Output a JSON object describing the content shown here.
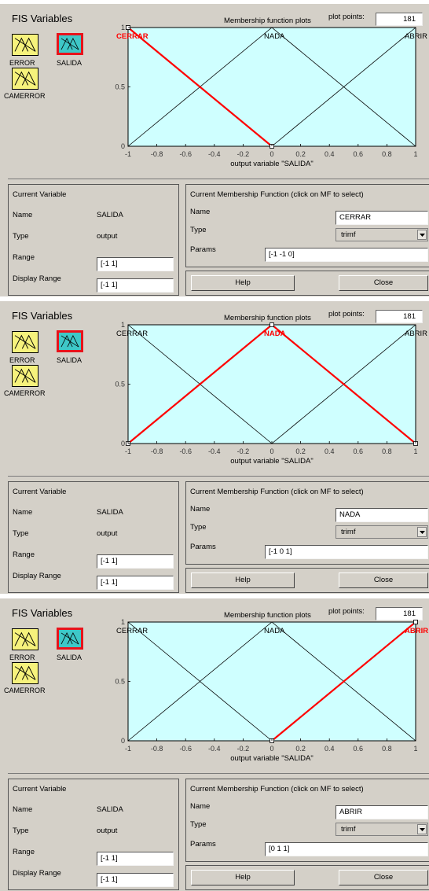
{
  "panels": [
    {
      "fis_variables_title": "FIS Variables",
      "inputs": [
        "ERROR",
        "CAMERROR"
      ],
      "output": "SALIDA",
      "plot_title": "Membership function plots",
      "plot_points_label": "plot points:",
      "plot_points_value": "181",
      "x_axis_label": "output variable \"SALIDA\"",
      "x_ticks": [
        "-1",
        "-0.8",
        "-0.6",
        "-0.4",
        "-0.2",
        "0",
        "0.2",
        "0.4",
        "0.6",
        "0.8",
        "1"
      ],
      "y_ticks": [
        "0",
        "0.5",
        "1"
      ],
      "mf_names": [
        "CERRAR",
        "NADA",
        "ABRIR"
      ],
      "selected_mf": 0,
      "current_variable": {
        "title": "Current Variable",
        "name_label": "Name",
        "name": "SALIDA",
        "type_label": "Type",
        "type": "output",
        "range_label": "Range",
        "range": "[-1 1]",
        "display_range_label": "Display Range",
        "display_range": "[-1 1]"
      },
      "current_mf": {
        "title": "Current Membership Function (click on MF to select)",
        "name_label": "Name",
        "name": "CERRAR",
        "type_label": "Type",
        "type": "trimf",
        "params_label": "Params",
        "params": "[-1 -1 0]"
      },
      "help_label": "Help",
      "close_label": "Close"
    },
    {
      "fis_variables_title": "FIS Variables",
      "inputs": [
        "ERROR",
        "CAMERROR"
      ],
      "output": "SALIDA",
      "plot_title": "Membership function plots",
      "plot_points_label": "plot points:",
      "plot_points_value": "181",
      "x_axis_label": "output variable \"SALIDA\"",
      "x_ticks": [
        "-1",
        "-0.8",
        "-0.6",
        "-0.4",
        "-0.2",
        "0",
        "0.2",
        "0.4",
        "0.6",
        "0.8",
        "1"
      ],
      "y_ticks": [
        "0",
        "0.5",
        "1"
      ],
      "mf_names": [
        "CERRAR",
        "NADA",
        "ABRIR"
      ],
      "selected_mf": 1,
      "current_variable": {
        "title": "Current Variable",
        "name_label": "Name",
        "name": "SALIDA",
        "type_label": "Type",
        "type": "output",
        "range_label": "Range",
        "range": "[-1 1]",
        "display_range_label": "Display Range",
        "display_range": "[-1 1]"
      },
      "current_mf": {
        "title": "Current Membership Function (click on MF to select)",
        "name_label": "Name",
        "name": "NADA",
        "type_label": "Type",
        "type": "trimf",
        "params_label": "Params",
        "params": "[-1 0 1]"
      },
      "help_label": "Help",
      "close_label": "Close"
    },
    {
      "fis_variables_title": "FIS Variables",
      "inputs": [
        "ERROR",
        "CAMERROR"
      ],
      "output": "SALIDA",
      "plot_title": "Membership function plots",
      "plot_points_label": "plot points:",
      "plot_points_value": "181",
      "x_axis_label": "output variable \"SALIDA\"",
      "x_ticks": [
        "-1",
        "-0.8",
        "-0.6",
        "-0.4",
        "-0.2",
        "0",
        "0.2",
        "0.4",
        "0.6",
        "0.8",
        "1"
      ],
      "y_ticks": [
        "0",
        "0.5",
        "1"
      ],
      "mf_names": [
        "CERRAR",
        "NADA",
        "ABRIR"
      ],
      "selected_mf": 2,
      "current_variable": {
        "title": "Current Variable",
        "name_label": "Name",
        "name": "SALIDA",
        "type_label": "Type",
        "type": "output",
        "range_label": "Range",
        "range": "[-1 1]",
        "display_range_label": "Display Range",
        "display_range": "[-1 1]"
      },
      "current_mf": {
        "title": "Current Membership Function (click on MF to select)",
        "name_label": "Name",
        "name": "ABRIR",
        "type_label": "Type",
        "type": "trimf",
        "params_label": "Params",
        "params": "[0 1 1]"
      },
      "help_label": "Help",
      "close_label": "Close"
    }
  ],
  "chart_data": {
    "type": "line",
    "xlim": [
      -1,
      1
    ],
    "ylim": [
      0,
      1
    ],
    "xlabel": "output variable \"SALIDA\"",
    "series": [
      {
        "name": "CERRAR",
        "x": [
          -1,
          -1,
          0
        ],
        "y": [
          1,
          1,
          0
        ]
      },
      {
        "name": "NADA",
        "x": [
          -1,
          0,
          1
        ],
        "y": [
          0,
          1,
          0
        ]
      },
      {
        "name": "ABRIR",
        "x": [
          0,
          1,
          1
        ],
        "y": [
          0,
          1,
          1
        ]
      }
    ],
    "colors": {
      "plot_background": "#cfffff",
      "unselected": "#000000",
      "selected": "#ff0000"
    }
  },
  "colors": {
    "window_bg": "#d4d0c8",
    "input_icon": "#f6f27c",
    "output_icon": "#3ec8c8",
    "selected_border": "#e8131b"
  }
}
